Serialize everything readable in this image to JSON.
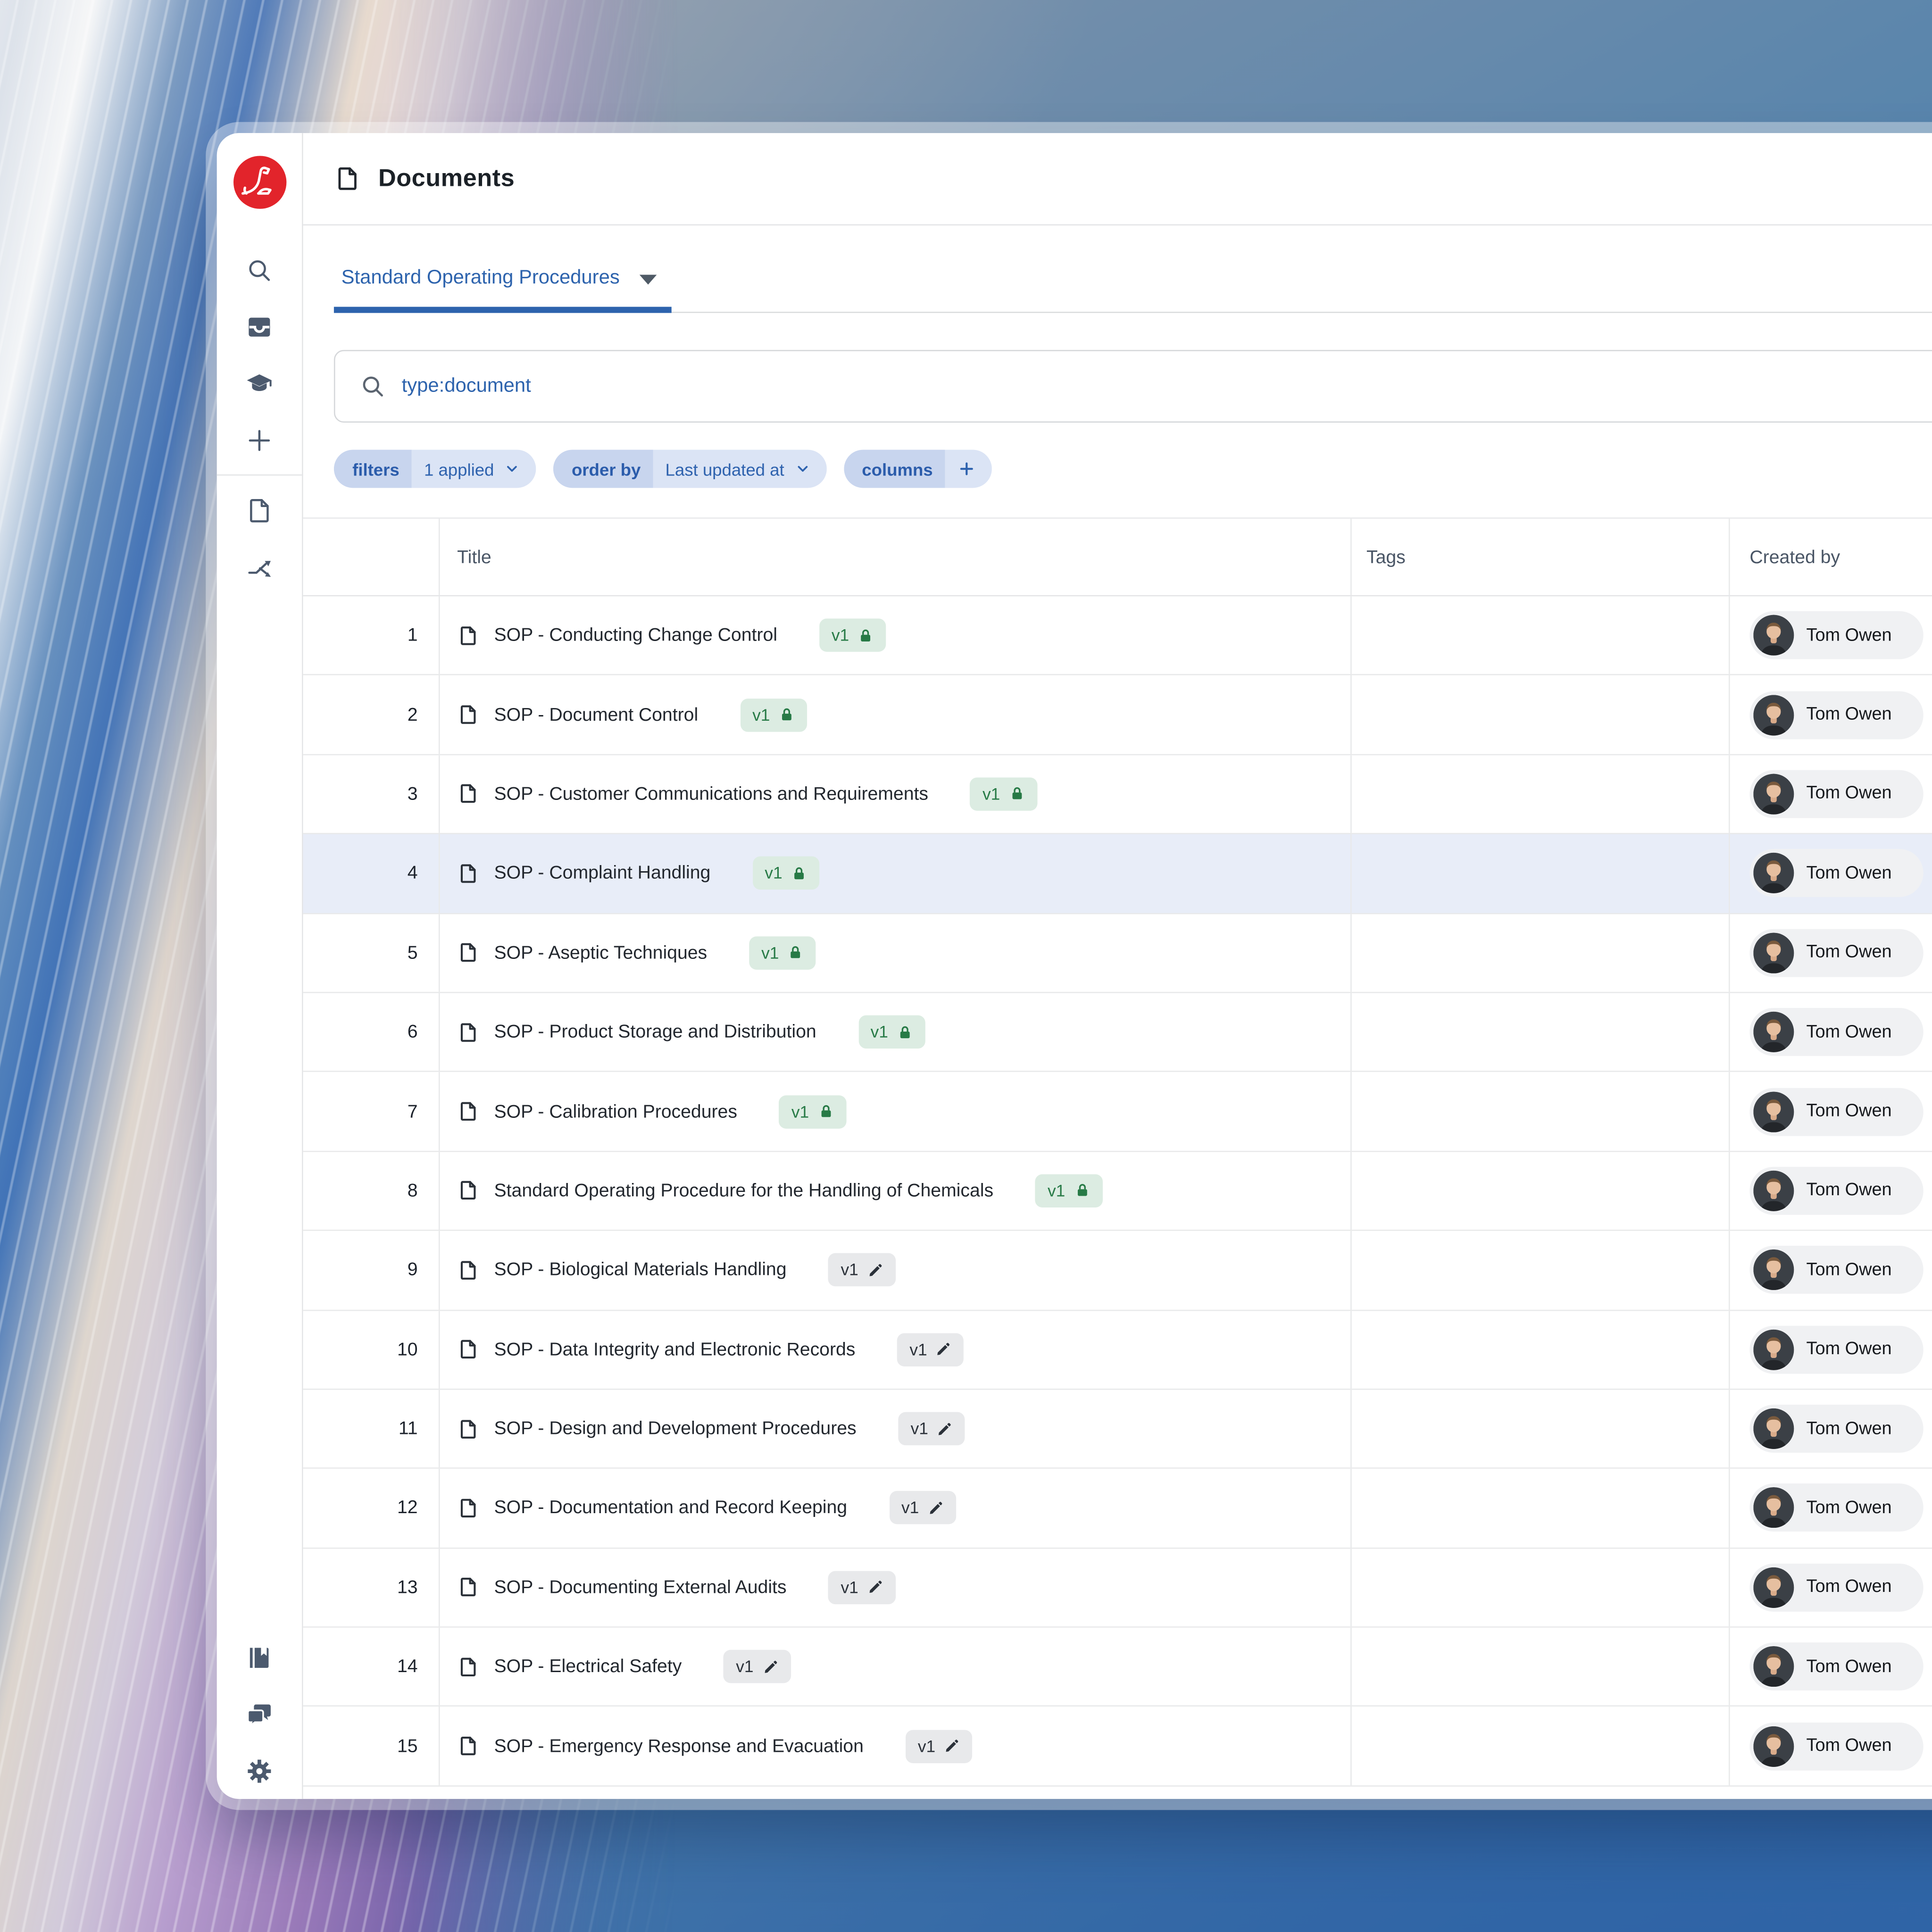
{
  "app": {
    "page_title": "Documents",
    "logo": "seal-logo",
    "brand_red": "#e2242b"
  },
  "sidebar": {
    "top_icons": [
      "search-icon",
      "inbox-icon",
      "graduation-cap-icon",
      "plus-icon",
      "document-icon",
      "workflow-arrows-icon"
    ],
    "bottom_icons": [
      "book-icon",
      "chat-bubbles-icon",
      "gear-icon"
    ]
  },
  "tabs": {
    "active_label": "Standard Operating Procedures"
  },
  "search": {
    "value": "type:document",
    "icon": "search-icon"
  },
  "toolbar": {
    "filters": {
      "label": "filters",
      "value": "1 applied"
    },
    "order_by": {
      "label": "order by",
      "value": "Last updated at"
    },
    "columns": {
      "label": "columns"
    }
  },
  "table": {
    "headers": {
      "title": "Title",
      "tags": "Tags",
      "created_by": "Created by"
    },
    "highlighted_row": 4,
    "rows": [
      {
        "num": 1,
        "title": "SOP - Conducting Change Control",
        "version": "v1",
        "status": "locked",
        "tags": "",
        "created_by": "Tom Owen"
      },
      {
        "num": 2,
        "title": "SOP - Document Control",
        "version": "v1",
        "status": "locked",
        "tags": "",
        "created_by": "Tom Owen"
      },
      {
        "num": 3,
        "title": "SOP - Customer Communications and Requirements",
        "version": "v1",
        "status": "locked",
        "tags": "",
        "created_by": "Tom Owen"
      },
      {
        "num": 4,
        "title": "SOP - Complaint Handling",
        "version": "v1",
        "status": "locked",
        "tags": "",
        "created_by": "Tom Owen"
      },
      {
        "num": 5,
        "title": "SOP - Aseptic Techniques",
        "version": "v1",
        "status": "locked",
        "tags": "",
        "created_by": "Tom Owen"
      },
      {
        "num": 6,
        "title": "SOP - Product Storage and Distribution",
        "version": "v1",
        "status": "locked",
        "tags": "",
        "created_by": "Tom Owen"
      },
      {
        "num": 7,
        "title": "SOP - Calibration Procedures",
        "version": "v1",
        "status": "locked",
        "tags": "",
        "created_by": "Tom Owen"
      },
      {
        "num": 8,
        "title": "Standard Operating Procedure for the Handling of Chemicals",
        "version": "v1",
        "status": "locked",
        "tags": "",
        "created_by": "Tom Owen"
      },
      {
        "num": 9,
        "title": "SOP - Biological Materials Handling",
        "version": "v1",
        "status": "draft",
        "tags": "",
        "created_by": "Tom Owen"
      },
      {
        "num": 10,
        "title": "SOP - Data Integrity and Electronic Records",
        "version": "v1",
        "status": "draft",
        "tags": "",
        "created_by": "Tom Owen"
      },
      {
        "num": 11,
        "title": "SOP - Design and Development Procedures",
        "version": "v1",
        "status": "draft",
        "tags": "",
        "created_by": "Tom Owen"
      },
      {
        "num": 12,
        "title": "SOP - Documentation and Record Keeping",
        "version": "v1",
        "status": "draft",
        "tags": "",
        "created_by": "Tom Owen"
      },
      {
        "num": 13,
        "title": "SOP - Documenting External Audits",
        "version": "v1",
        "status": "draft",
        "tags": "",
        "created_by": "Tom Owen"
      },
      {
        "num": 14,
        "title": "SOP - Electrical Safety",
        "version": "v1",
        "status": "draft",
        "tags": "",
        "created_by": "Tom Owen"
      },
      {
        "num": 15,
        "title": "SOP - Emergency Response and Evacuation",
        "version": "v1",
        "status": "draft",
        "tags": "",
        "created_by": "Tom Owen"
      }
    ]
  },
  "colors": {
    "link_blue": "#2d63ad",
    "chip_label_bg": "#c8d5ee",
    "chip_value_bg": "#dbe4f5",
    "badge_locked_bg": "#dcece2",
    "badge_locked_fg": "#277a46",
    "badge_draft_bg": "#e8e9eb",
    "badge_draft_fg": "#2b3139",
    "row_highlight": "#e8edf8",
    "brand_red": "#e2242b"
  }
}
